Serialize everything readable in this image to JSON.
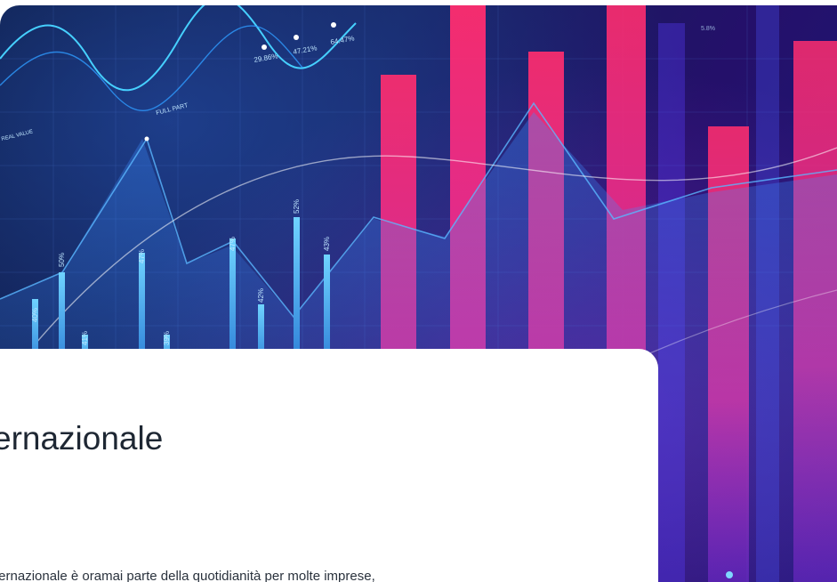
{
  "hero": {
    "image_name": "financial-chart-graphic",
    "labels": {
      "part_label": "FULL PART",
      "left_label": "REAL VALUE",
      "top_values": [
        "29.86%",
        "47.21%",
        "64.47%"
      ],
      "right_value": "5.8%",
      "bar_values": [
        "40%",
        "50%",
        "41%",
        "47%",
        "39%",
        "47%",
        "42%",
        "52%",
        "43%"
      ]
    }
  },
  "card": {
    "title": "ernazionale",
    "text": "ternazionale è oramai parte della quotidianità per molte imprese,"
  },
  "colors": {
    "hero_dark": "#0a1335",
    "bar_pink": "#ff2d6e",
    "bar_blue": "#3fb8ff",
    "title_text": "#1e2733"
  }
}
